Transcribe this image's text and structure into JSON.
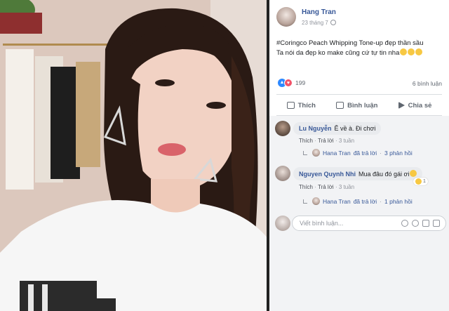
{
  "post": {
    "author": "Hang Tran",
    "time": "23 tháng 7",
    "text_line1": "#Coringco Peach Whipping Tone-up đẹp thần sầu",
    "text_line2": "Ta nói da đẹp ko make cũng cứ tự tin nha",
    "reaction_count": "199",
    "comment_count": "6 bình luận"
  },
  "actions": {
    "like": "Thích",
    "comment": "Bình luận",
    "share": "Chia sẻ"
  },
  "comments": [
    {
      "name": "Lu Nguyễn",
      "text": "Ê về à. Đi chơi",
      "like": "Thích",
      "reply": "Trả lời",
      "time": "3 tuần",
      "reply_author": "Hana Tran",
      "reply_action": "đã trả lời",
      "reply_count": "3 phản hồi"
    },
    {
      "name": "Nguyen Quynh Nhi",
      "text": "Mua đâu đó gái ơi",
      "like": "Thích",
      "reply": "Trả lời",
      "time": "3 tuần",
      "reply_author": "Hana Tran",
      "reply_action": "đã trả lời",
      "reply_count": "1 phản hồi",
      "reaction_count": "1"
    }
  ],
  "composer": {
    "placeholder": "Viết bình luận..."
  },
  "colors": {
    "link_blue": "#385898",
    "like_blue": "#2e89ff",
    "love_red": "#f25268"
  }
}
